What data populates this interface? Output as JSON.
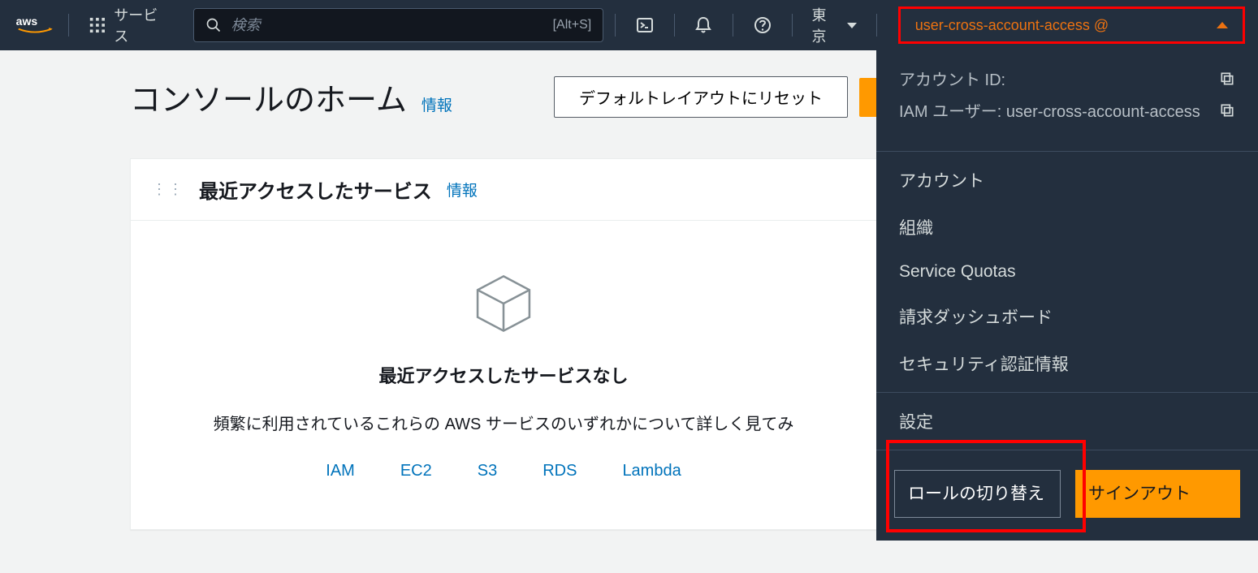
{
  "topnav": {
    "services_label": "サービス",
    "search_placeholder": "検索",
    "search_shortcut": "[Alt+S]",
    "region_label": "東京",
    "account_label": "user-cross-account-access @"
  },
  "dropdown": {
    "account_id_label": "アカウント ID:",
    "iam_user_label": "IAM ユーザー: user-cross-account-access",
    "items": [
      {
        "label": "アカウント"
      },
      {
        "label": "組織"
      },
      {
        "label": "Service Quotas"
      },
      {
        "label": "請求ダッシュボード"
      },
      {
        "label": "セキュリティ認証情報"
      }
    ],
    "settings_label": "設定",
    "switch_role_label": "ロールの切り替え",
    "signout_label": "サインアウト"
  },
  "main": {
    "title": "コンソールのホーム",
    "info_label": "情報",
    "reset_button": "デフォルトレイアウトにリセット"
  },
  "card": {
    "title": "最近アクセスしたサービス",
    "info_label": "情報",
    "empty_title": "最近アクセスしたサービスなし",
    "empty_desc": "頻繁に利用されているこれらの AWS サービスのいずれかについて詳しく見てみ",
    "services": [
      "IAM",
      "EC2",
      "S3",
      "RDS",
      "Lambda"
    ]
  }
}
